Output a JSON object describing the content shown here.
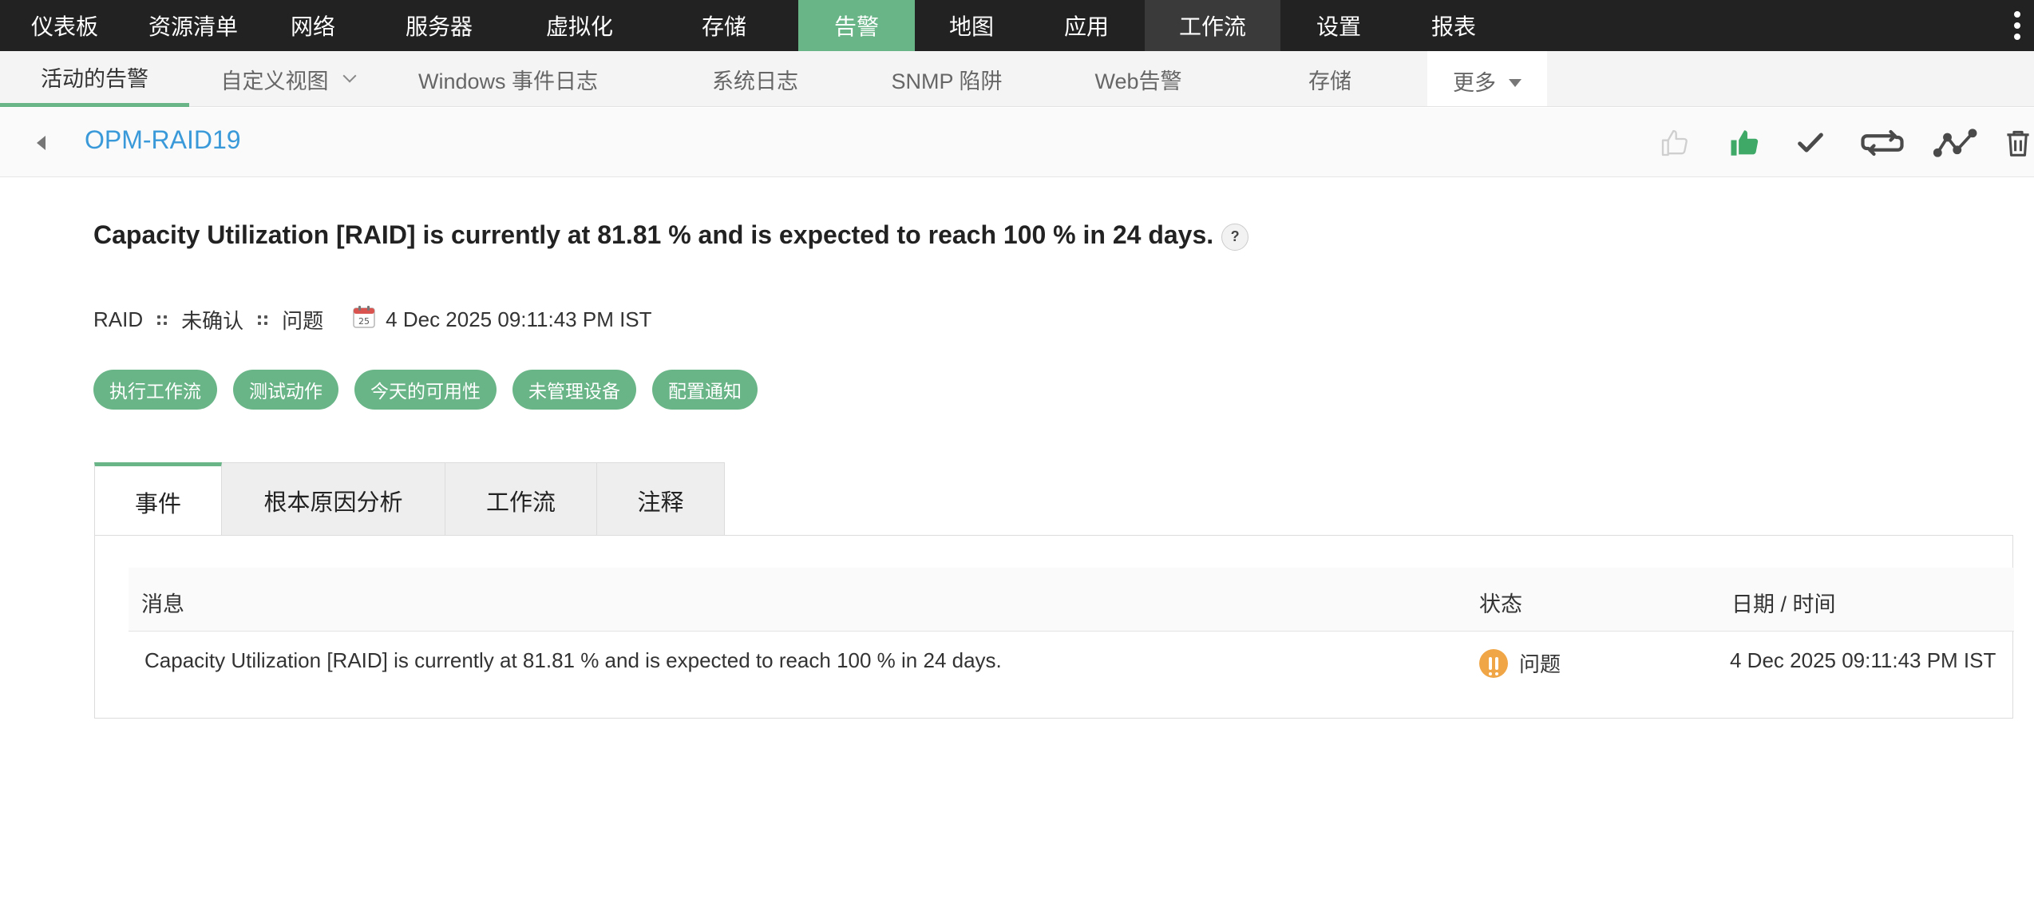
{
  "topnav": {
    "items": [
      {
        "label": "仪表板"
      },
      {
        "label": "资源清单"
      },
      {
        "label": "网络"
      },
      {
        "label": "服务器"
      },
      {
        "label": "虚拟化"
      },
      {
        "label": "存储"
      },
      {
        "label": "告警"
      },
      {
        "label": "地图"
      },
      {
        "label": "应用"
      },
      {
        "label": "工作流"
      },
      {
        "label": "设置"
      },
      {
        "label": "报表"
      }
    ],
    "active_index": 6
  },
  "subnav": {
    "items": [
      {
        "label": "活动的告警"
      },
      {
        "label": "自定义视图"
      },
      {
        "label": "Windows 事件日志"
      },
      {
        "label": "系统日志"
      },
      {
        "label": "SNMP 陷阱"
      },
      {
        "label": "Web告警"
      },
      {
        "label": "存储"
      },
      {
        "label": "更多"
      }
    ],
    "active_index": 0
  },
  "header": {
    "device_name": "OPM-RAID19"
  },
  "alarm": {
    "title": "Capacity Utilization [RAID] is currently at 81.81 % and is expected to reach 100 % in 24 days.",
    "help_label": "?",
    "category": "RAID",
    "ack_status": "未确认",
    "severity": "问题",
    "timestamp": "4 Dec 2025 09:11:43 PM IST",
    "calendar_day": "25"
  },
  "pills": [
    {
      "label": "执行工作流"
    },
    {
      "label": "测试动作"
    },
    {
      "label": "今天的可用性"
    },
    {
      "label": "未管理设备"
    },
    {
      "label": "配置通知"
    }
  ],
  "tabs": [
    {
      "label": "事件"
    },
    {
      "label": "根本原因分析"
    },
    {
      "label": "工作流"
    },
    {
      "label": "注释"
    }
  ],
  "events_table": {
    "columns": [
      "消息",
      "状态",
      "日期 / 时间"
    ],
    "rows": [
      {
        "message": "Capacity Utilization [RAID] is currently at 81.81 % and is expected to reach 100 % in 24 days.",
        "status": "问题",
        "datetime": "4 Dec 2025 09:11:43 PM IST"
      }
    ]
  },
  "colors": {
    "accent": "#6ab588",
    "topnav_bg": "#222222",
    "link": "#3a9ad9",
    "status_trouble": "#f0a647"
  }
}
